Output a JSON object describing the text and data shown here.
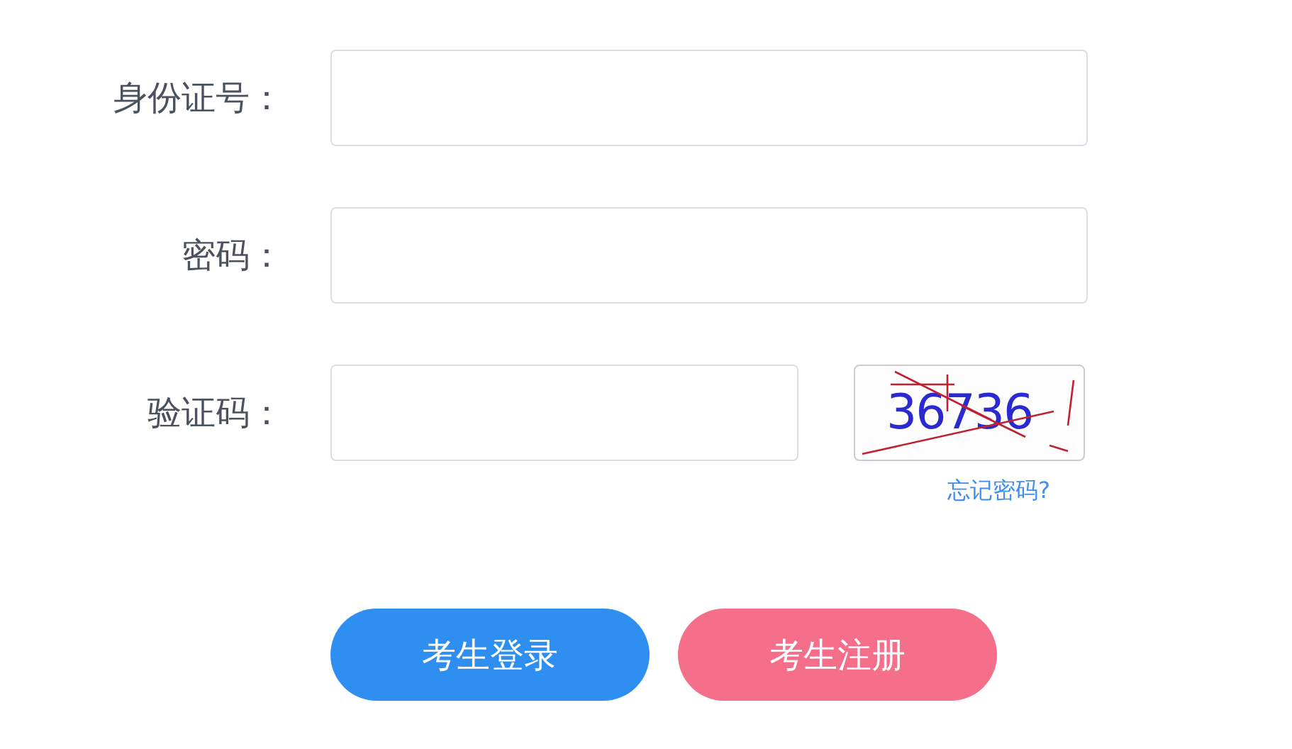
{
  "fields": [
    {
      "label": "身份证号：",
      "kind": "text"
    },
    {
      "label": "密码：",
      "kind": "password"
    },
    {
      "label": "验证码：",
      "kind": "captcha",
      "captcha": "36736"
    }
  ],
  "forgot_link": "忘记密码?",
  "buttons": [
    {
      "label": "考生登录",
      "color": "#2f8ff0"
    },
    {
      "label": "考生注册",
      "color": "#f56f8b"
    }
  ]
}
